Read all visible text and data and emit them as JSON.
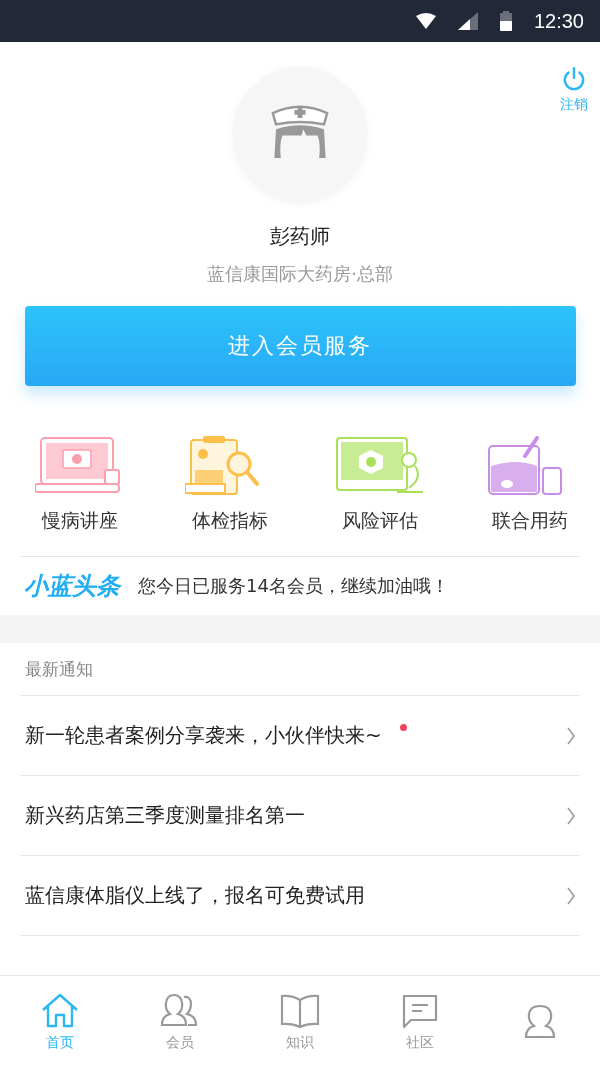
{
  "status_bar": {
    "time": "12:30"
  },
  "logout": {
    "label": "注销"
  },
  "profile": {
    "name": "彭药师",
    "store": "蓝信康国际大药房·总部"
  },
  "member_button": {
    "label": "进入会员服务"
  },
  "services": [
    {
      "label": "慢病讲座",
      "kind": "lecture",
      "color": "#fb9fae"
    },
    {
      "label": "体检指标",
      "kind": "report",
      "color": "#fcc04a"
    },
    {
      "label": "风险评估",
      "kind": "risk",
      "color": "#a9e25a"
    },
    {
      "label": "联合用药",
      "kind": "medicine",
      "color": "#c98ce8"
    }
  ],
  "headline": {
    "logo": "小蓝头条",
    "text": "您今日已服务14名会员，继续加油哦！"
  },
  "notices": {
    "title": "最新通知",
    "items": [
      {
        "text": "新一轮患者案例分享袭来，小伙伴快来~",
        "unread": true
      },
      {
        "text": "新兴药店第三季度测量排名第一",
        "unread": false
      },
      {
        "text": "蓝信康体脂仪上线了，报名可免费试用",
        "unread": false
      }
    ]
  },
  "tab_bar": [
    {
      "label": "首页",
      "kind": "home",
      "selected": true
    },
    {
      "label": "会员",
      "kind": "members",
      "selected": false
    },
    {
      "label": "知识",
      "kind": "book",
      "selected": false
    },
    {
      "label": "社区",
      "kind": "chat",
      "selected": false
    },
    {
      "kind": "person",
      "selected": false
    }
  ]
}
